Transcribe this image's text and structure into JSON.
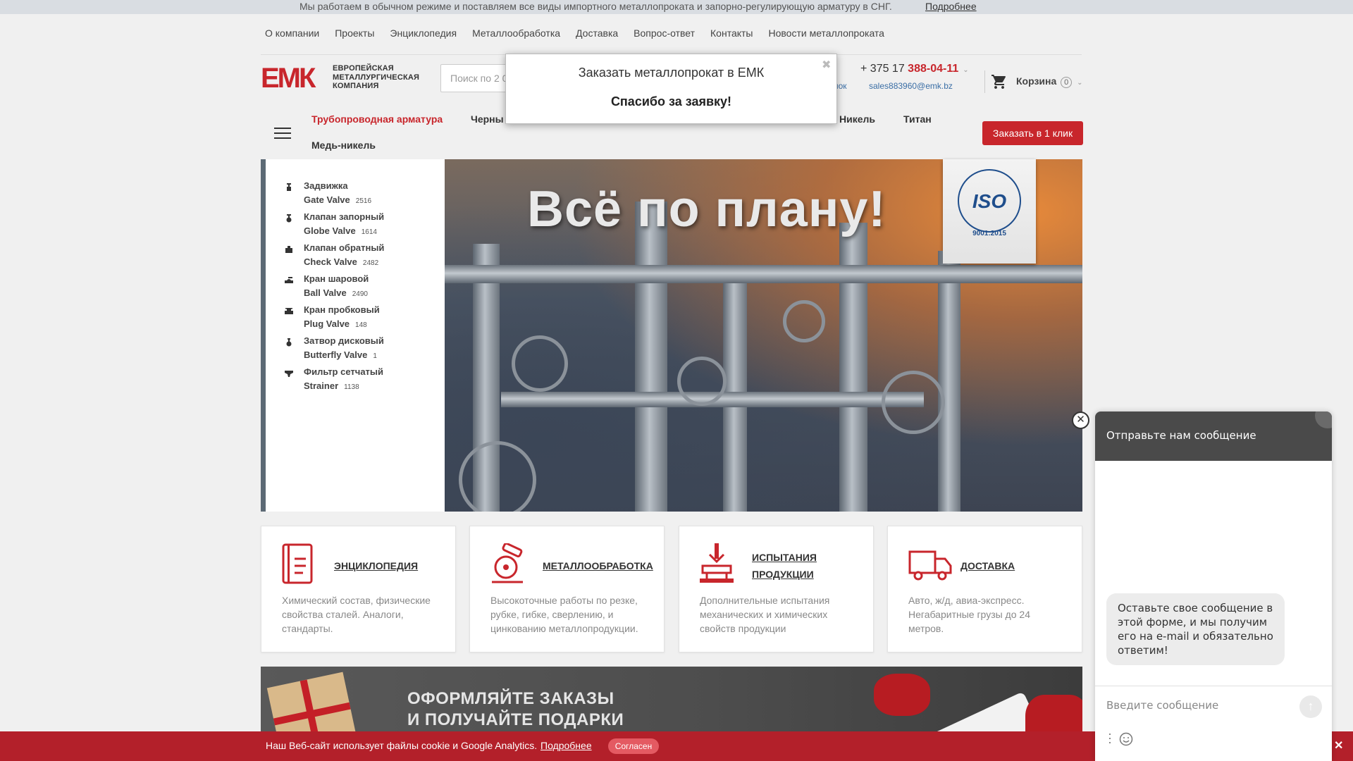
{
  "topbar": {
    "message": "Мы работаем в обычном режиме и поставляем все виды импортного металлопроката и запорно-регулирующую арматуру в СНГ.",
    "more": "Подробнее"
  },
  "mainnav": [
    "О компании",
    "Проекты",
    "Энциклопедия",
    "Металлообработка",
    "Доставка",
    "Вопрос-ответ",
    "Контакты",
    "Новости металлопроката"
  ],
  "logo": {
    "mark": "ЕМК",
    "line1": "ЕВРОПЕЙСКАЯ",
    "line2": "МЕТАЛЛУРГИЧЕСКАЯ",
    "line3": "КОМПАНИЯ"
  },
  "search": {
    "placeholder": "Поиск по 2 0"
  },
  "contacts": {
    "phone_prefix": "+ 375 17 ",
    "phone_main": "388-04-11",
    "callback": "нок",
    "email": "sales883960@emk.bz"
  },
  "cart": {
    "label": "Корзина",
    "count": "0"
  },
  "categories": [
    "Трубопроводная арматура",
    "Черны",
    "Никель",
    "Титан",
    "Медь-никель"
  ],
  "order_button": "Заказать в 1 клик",
  "sidebar": [
    {
      "ru": "Задвижка",
      "en": "Gate Valve",
      "count": "2516"
    },
    {
      "ru": "Клапан запорный",
      "en": "Globe Valve",
      "count": "1614"
    },
    {
      "ru": "Клапан обратный",
      "en": "Check Valve",
      "count": "2482"
    },
    {
      "ru": "Кран шаровой",
      "en": "Ball Valve",
      "count": "2490"
    },
    {
      "ru": "Кран пробковый",
      "en": "Plug Valve",
      "count": "148"
    },
    {
      "ru": "Затвор дисковый",
      "en": "Butterfly Valve",
      "count": "1"
    },
    {
      "ru": "Фильтр сетчатый",
      "en": "Strainer",
      "count": "1138"
    }
  ],
  "banner": {
    "slogan": "Всё по плану!",
    "iso_word": "ISO",
    "iso_std": "9001:2015"
  },
  "cards": [
    {
      "title": "ЭНЦИКЛОПЕДИЯ",
      "desc": "Химический состав, физические свойства сталей. Аналоги, стандарты.",
      "icon": "book-icon"
    },
    {
      "title": "МЕТАЛЛООБРАБОТКА",
      "desc": "Высокоточные работы по резке, рубке, гибке, сверлению, и цинкованию металлопродукции.",
      "icon": "saw-icon"
    },
    {
      "title": "ИСПЫТАНИЯ ПРОДУКЦИИ",
      "desc": "Дополнительные испытания механических и химических свойств продукции",
      "icon": "press-icon"
    },
    {
      "title": "ДОСТАВКА",
      "desc": "Авто, ж/д, авиа-экспресс. Негабаритные грузы до 24 метров.",
      "icon": "truck-icon"
    }
  ],
  "promo": {
    "line1": "ОФОРМЛЯЙТЕ ЗАКАЗЫ",
    "line2": "И ПОЛУЧАЙТЕ ПОДАРКИ"
  },
  "cookie": {
    "text": "Наш Веб-сайт использует файлы cookie и Google Analytics.",
    "more": "Подробнее",
    "ok": "Согласен"
  },
  "modal": {
    "title": "Заказать металлопрокат в ЕМК",
    "thanks": "Спасибо за заявку!"
  },
  "chat": {
    "header": "Отправьте нам сообщение",
    "bubble": "Оставьте свое сообщение в этой форме, и мы получим его на e-mail и обязательно ответим!",
    "placeholder": "Введите сообщение"
  },
  "colors": {
    "brand_red": "#c8262c",
    "link_blue": "#3a6ea5",
    "chat_dark": "#4a4a4a"
  }
}
